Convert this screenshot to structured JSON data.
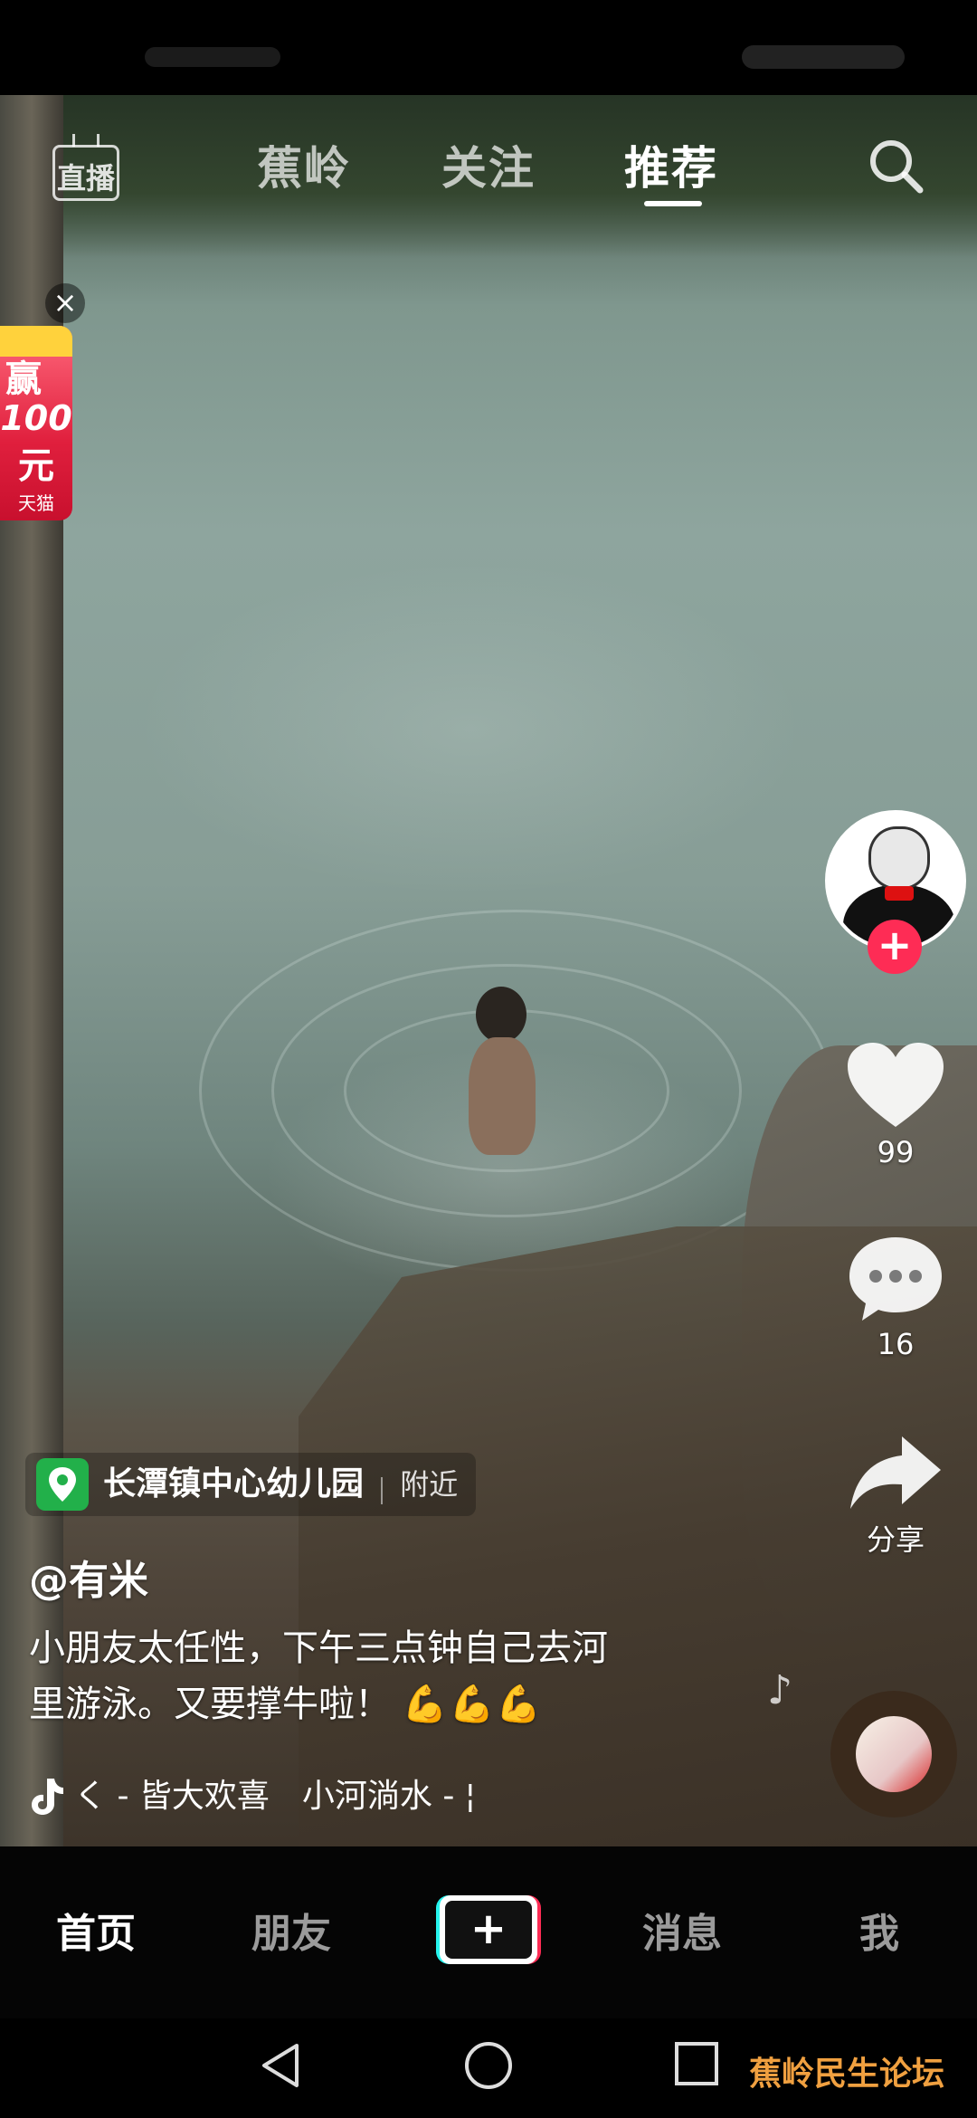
{
  "top_nav": {
    "live_label": "直播",
    "tabs": [
      {
        "label": "蕉岭"
      },
      {
        "label": "关注"
      },
      {
        "label": "推荐"
      }
    ],
    "active_tab": "推荐"
  },
  "promo_badge": {
    "win": "赢",
    "amount": "100",
    "unit": "元",
    "brand": "天猫"
  },
  "actions": {
    "likes": "99",
    "comments": "16",
    "share_label": "分享"
  },
  "post": {
    "location": "长潭镇中心幼儿园",
    "location_tag": "附近",
    "author": "@有米",
    "caption_line1": "小朋友太任性，下午三点钟自己去河",
    "caption_line2": "里游泳。又要撑牛啦！",
    "caption_emoji": "💪💪💪",
    "music": "く - 皆大欢喜　小河淌水 - ¦"
  },
  "bottom_tabs": {
    "home": "首页",
    "friends": "朋友",
    "create": "+",
    "messages": "消息",
    "me": "我"
  },
  "active_bottom_tab": "首页",
  "watermark": "蕉岭民生论坛",
  "colors": {
    "follow_red": "#fe2c55",
    "create_cyan": "#25f4ee",
    "location_green": "#22b04a",
    "watermark_orange": "#f0a040"
  }
}
